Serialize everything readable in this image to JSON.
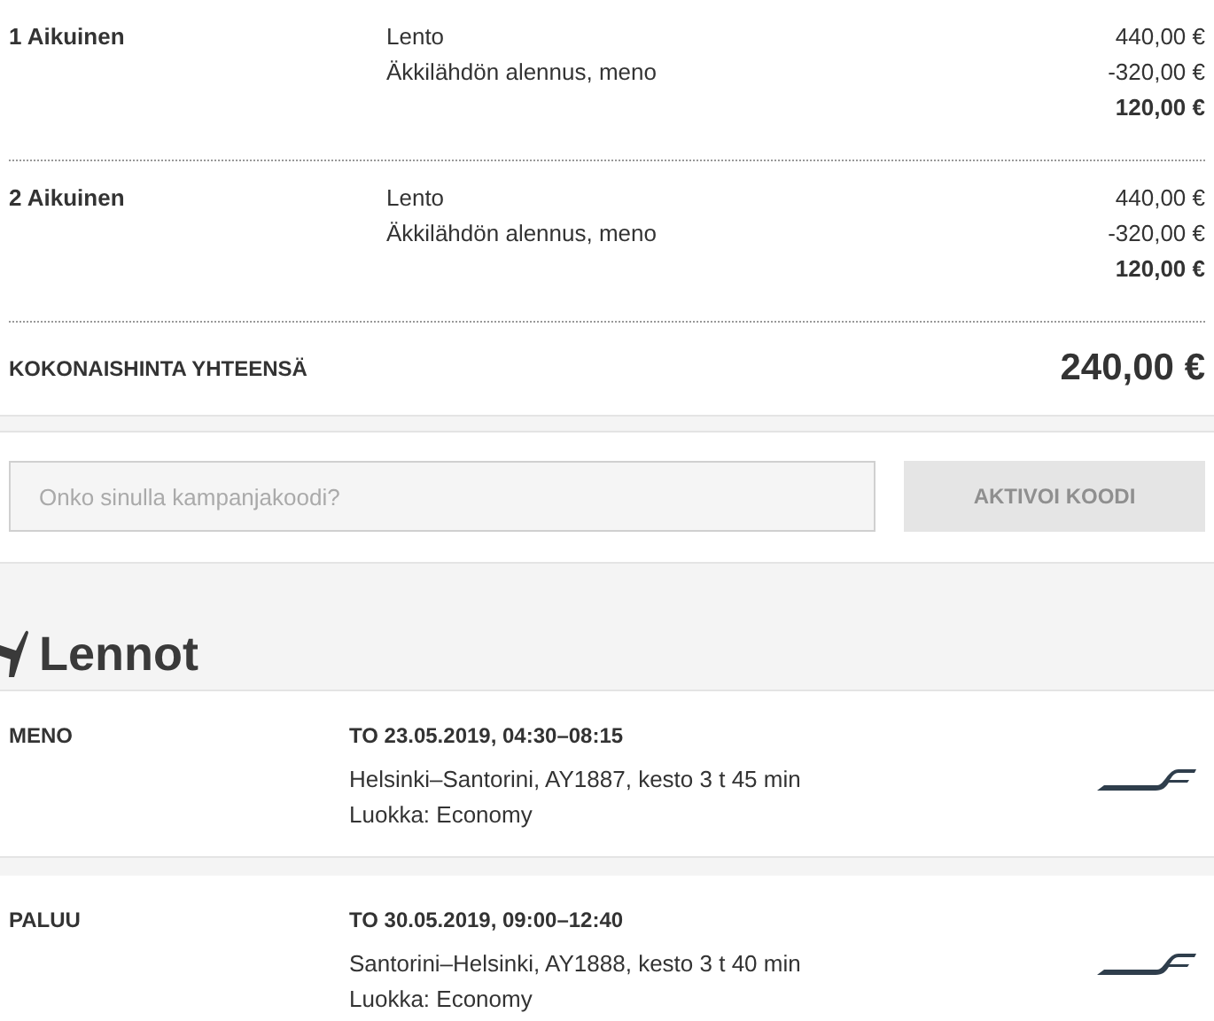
{
  "passengers": [
    {
      "name": "1 Aikuinen",
      "lines": [
        {
          "label": "Lento",
          "amount": "440,00 €"
        },
        {
          "label": "Äkkilähdön alennus, meno",
          "amount": "-320,00 €"
        }
      ],
      "subtotal": "120,00 €"
    },
    {
      "name": "2 Aikuinen",
      "lines": [
        {
          "label": "Lento",
          "amount": "440,00 €"
        },
        {
          "label": "Äkkilähdön alennus, meno",
          "amount": "-320,00 €"
        }
      ],
      "subtotal": "120,00 €"
    }
  ],
  "total": {
    "label": "KOKONAISHINTA YHTEENSÄ",
    "amount": "240,00 €"
  },
  "promo": {
    "placeholder": "Onko sinulla kampanjakoodi?",
    "button": "AKTIVOI KOODI",
    "disabled": true
  },
  "section_title": "Lennot",
  "flights": [
    {
      "direction": "MENO",
      "datetime": "TO 23.05.2019, 04:30–08:15",
      "route": "Helsinki–Santorini, AY1887, kesto 3 t 45 min",
      "class": "Luokka: Economy"
    },
    {
      "direction": "PALUU",
      "datetime": "TO 30.05.2019, 09:00–12:40",
      "route": "Santorini–Helsinki, AY1888, kesto 3 t 40 min",
      "class": "Luokka: Economy"
    }
  ]
}
